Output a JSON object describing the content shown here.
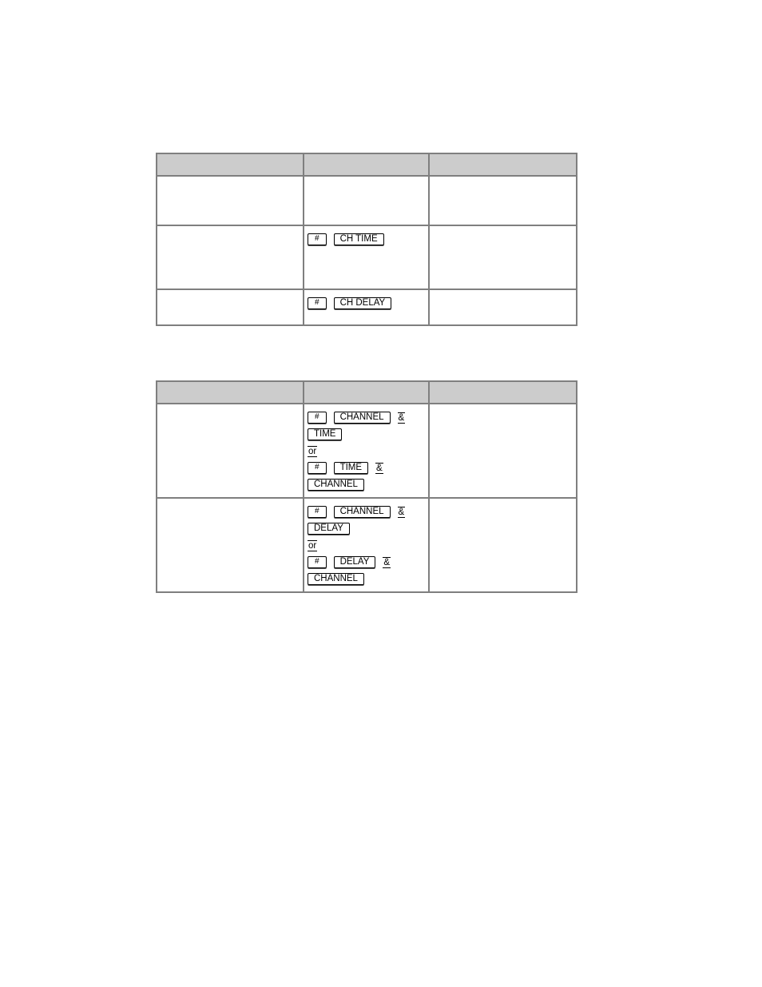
{
  "table1": {
    "header": [
      "",
      "",
      ""
    ],
    "rows": [
      {
        "col1": "",
        "col3": "",
        "keys": []
      },
      {
        "col1": "",
        "col3": "",
        "keys": [
          "#",
          "CH TIME"
        ]
      },
      {
        "col1": "",
        "col3": "",
        "keys": [
          "#",
          "CH DELAY"
        ]
      }
    ]
  },
  "table2": {
    "header": [
      "",
      "",
      ""
    ],
    "connector_and": "&",
    "connector_or": "or",
    "rows": [
      {
        "col1": "",
        "col3": "",
        "sequence_a": [
          "#",
          "CHANNEL",
          "TIME"
        ],
        "sequence_b": [
          "#",
          "TIME",
          "CHANNEL"
        ]
      },
      {
        "col1": "",
        "col3": "",
        "sequence_a": [
          "#",
          "CHANNEL",
          "DELAY"
        ],
        "sequence_b": [
          "#",
          "DELAY",
          "CHANNEL"
        ]
      }
    ]
  },
  "colors": {
    "header_bg": "#cccccc",
    "border": "#7f7f7f"
  }
}
